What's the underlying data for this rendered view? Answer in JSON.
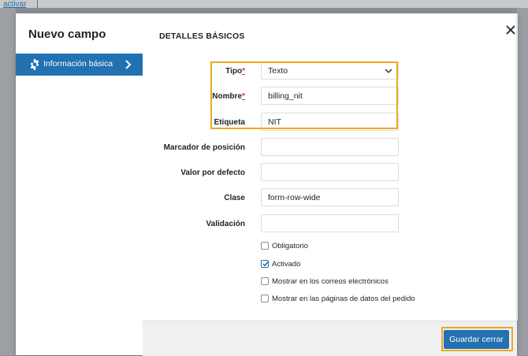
{
  "background": {
    "link_text": "activar"
  },
  "sidebar": {
    "title": "Nuevo campo",
    "items": [
      {
        "label": "Información básica",
        "icon": "gear-icon",
        "active": true
      }
    ]
  },
  "content": {
    "section_title": "DETALLES BÁSICOS",
    "fields": {
      "tipo": {
        "label": "Tipo",
        "required_mark": "*",
        "value": "Texto"
      },
      "nombre": {
        "label": "Nombre",
        "required_mark": "*",
        "value": "billing_nit"
      },
      "etiqueta": {
        "label": "Etiqueta",
        "value": "NIT"
      },
      "placeholder": {
        "label": "Marcador de posición",
        "value": ""
      },
      "default": {
        "label": "Valor por defecto",
        "value": ""
      },
      "clase": {
        "label": "Clase",
        "value": "form-row-wide"
      },
      "validacion": {
        "label": "Validación",
        "value": ""
      }
    },
    "checkboxes": [
      {
        "label": "Obligatorio",
        "checked": false
      },
      {
        "label": "Activado",
        "checked": true
      },
      {
        "label": "Mostrar en los correos electrónicos",
        "checked": false
      },
      {
        "label": "Mostrar en las páginas de datos del pedido",
        "checked": false
      }
    ]
  },
  "footer": {
    "save_label": "Guardar cerrar"
  },
  "colors": {
    "accent": "#2271b1",
    "highlight": "#f0a81c",
    "required": "#d63638"
  }
}
